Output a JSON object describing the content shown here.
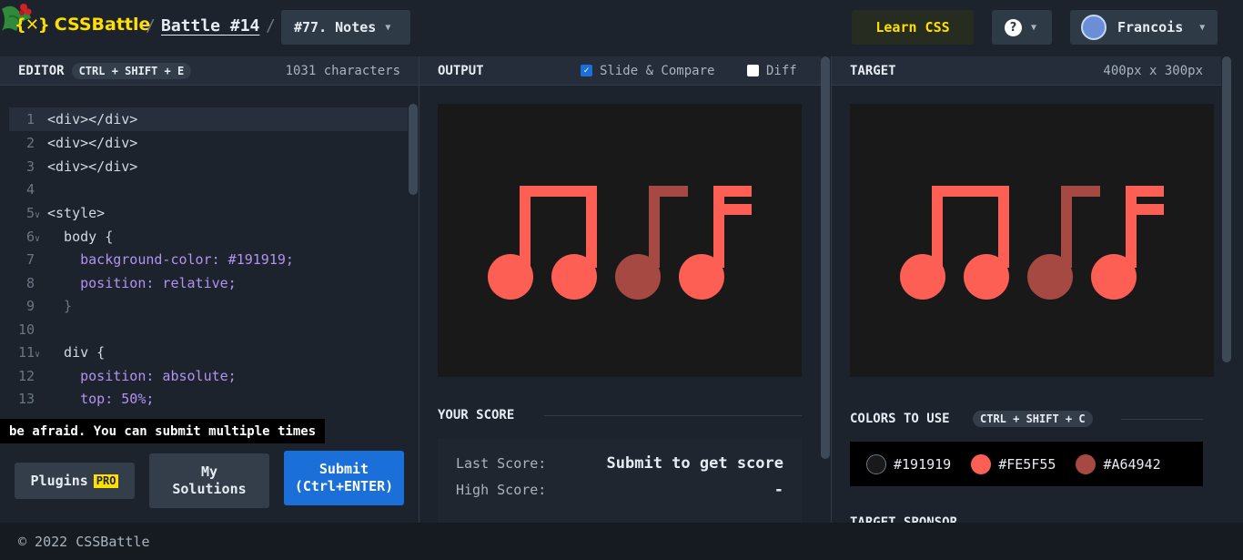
{
  "header": {
    "brand": "CSSBattle",
    "battle": "Battle #14",
    "target_select": "#77. Notes",
    "learn_css": "Learn CSS",
    "help": "?",
    "user_name": "Francois"
  },
  "editor": {
    "title": "EDITOR",
    "shortcut": "CTRL + SHIFT + E",
    "char_count": "1031 characters",
    "lines": [
      {
        "n": "1",
        "fold": "",
        "code": "<div></div>"
      },
      {
        "n": "2",
        "fold": "",
        "code": "<div></div>"
      },
      {
        "n": "3",
        "fold": "",
        "code": "<div></div>"
      },
      {
        "n": "4",
        "fold": "",
        "code": ""
      },
      {
        "n": "5",
        "fold": "v",
        "code": "<style>"
      },
      {
        "n": "6",
        "fold": "v",
        "code": "  body {"
      },
      {
        "n": "7",
        "fold": "",
        "code": "    background-color: #191919;"
      },
      {
        "n": "8",
        "fold": "",
        "code": "    position: relative;"
      },
      {
        "n": "9",
        "fold": "",
        "code": "  }"
      },
      {
        "n": "10",
        "fold": "",
        "code": ""
      },
      {
        "n": "11",
        "fold": "v",
        "code": "  div {"
      },
      {
        "n": "12",
        "fold": "",
        "code": "    position: absolute;"
      },
      {
        "n": "13",
        "fold": "",
        "code": "    top: 50%;"
      }
    ],
    "tooltip": "be afraid. You can submit multiple times",
    "plugins_label": "Plugins",
    "pro_badge": "PRO",
    "solutions_line1": "My",
    "solutions_line2": "Solutions",
    "submit_line1": "Submit",
    "submit_line2": "(Ctrl+ENTER)"
  },
  "output": {
    "title": "OUTPUT",
    "slide_compare": "Slide & Compare",
    "diff": "Diff",
    "slide_checked": true,
    "diff_checked": false
  },
  "score": {
    "title": "YOUR SCORE",
    "last_label": "Last Score:",
    "last_value": "Submit to get score",
    "high_label": "High Score:",
    "high_value": "-"
  },
  "target": {
    "title": "TARGET",
    "size": "400px x 300px",
    "colors_title": "COLORS TO USE",
    "colors_shortcut": "CTRL + SHIFT + C",
    "colors": [
      {
        "hex": "#191919",
        "label": "#191919"
      },
      {
        "hex": "#FE5F55",
        "label": "#FE5F55"
      },
      {
        "hex": "#A64942",
        "label": "#A64942"
      }
    ],
    "sponsor_title": "TARGET SPONSOR"
  },
  "footer": {
    "copyright": "© 2022 CSSBattle"
  },
  "colors": {
    "accent_yellow": "#ffdf00",
    "submit_blue": "#1a6fd8",
    "note_bright": "#FE5F55",
    "note_dark": "#A64942",
    "canvas_bg": "#191919"
  }
}
